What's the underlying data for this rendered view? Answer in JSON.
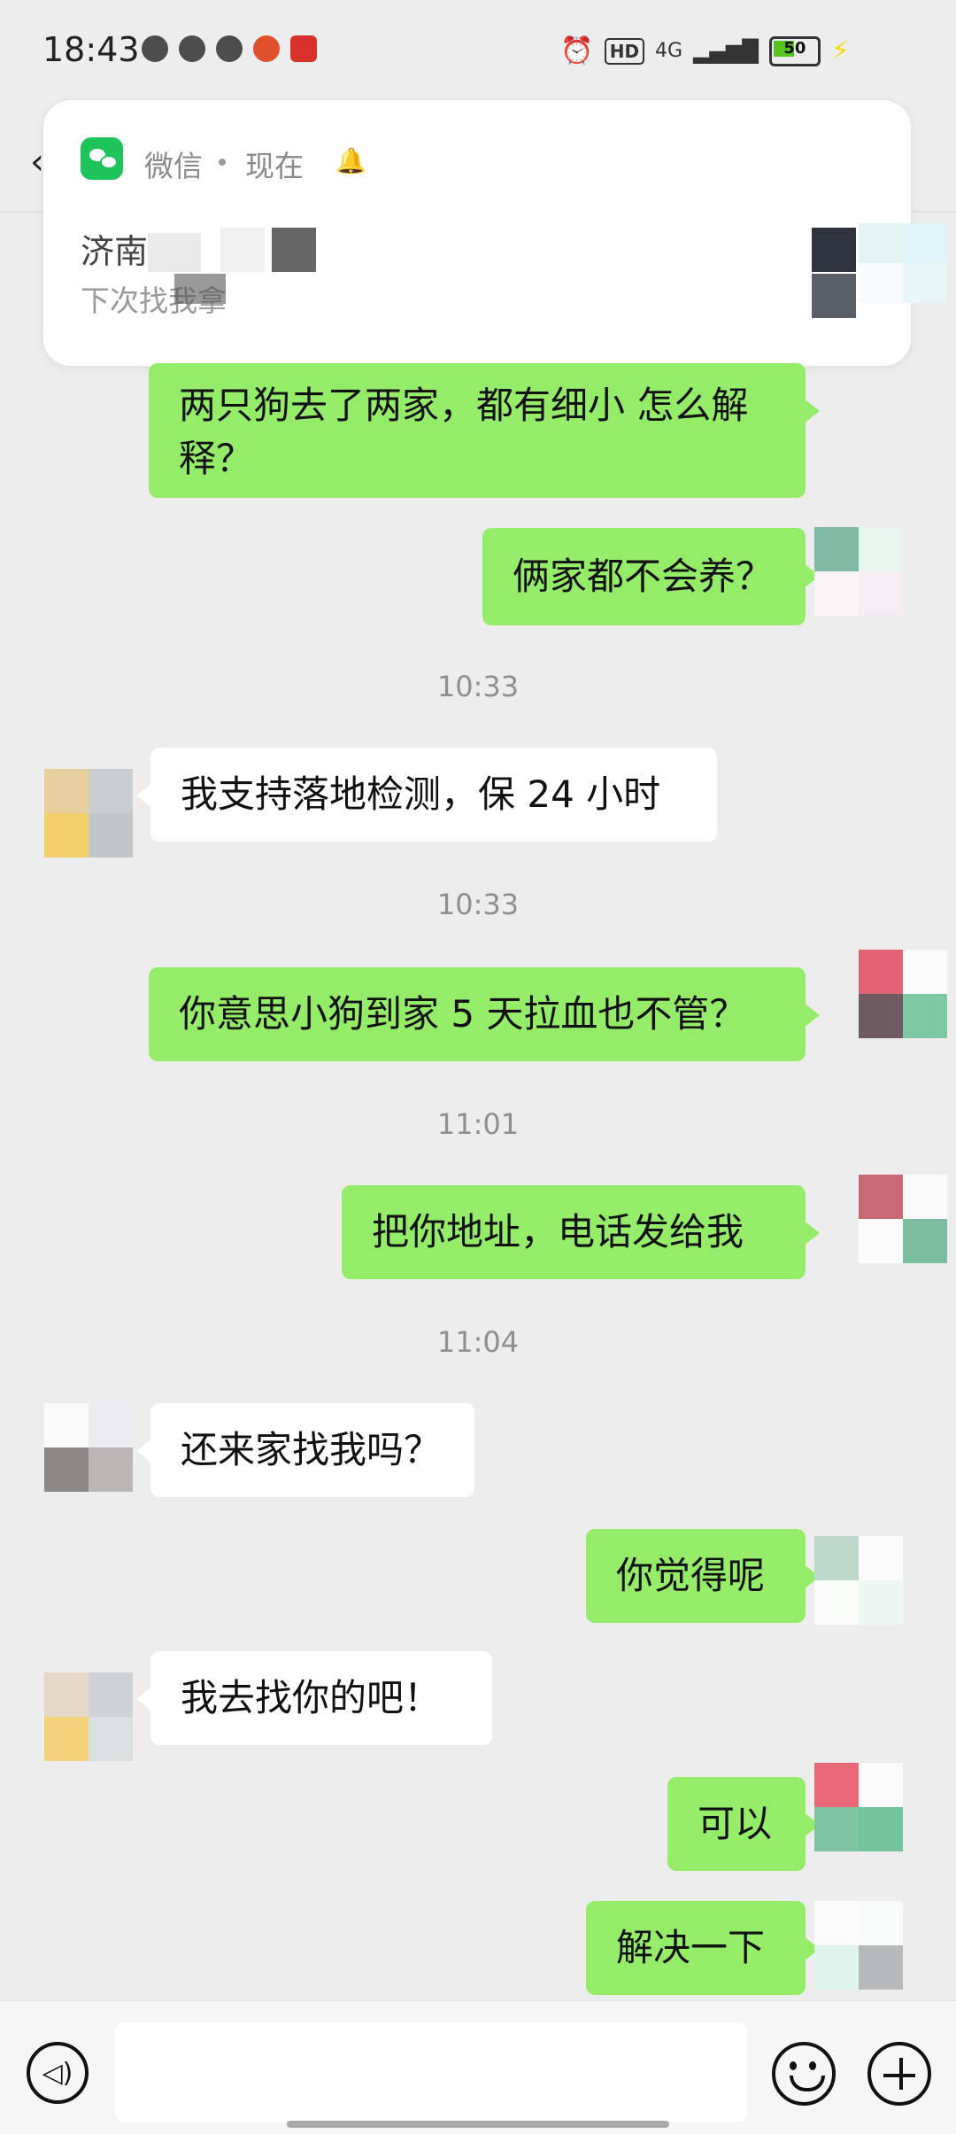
{
  "status_bar": {
    "time": "18:43",
    "network": "4G",
    "hd": "HD",
    "battery_level": "50",
    "icons": [
      "wechat-icon",
      "qq-browser-icon",
      "gauge-icon",
      "weibo-icon",
      "app-icon",
      "alarm-icon",
      "hd-icon",
      "signal-icon",
      "battery-icon",
      "charging-icon"
    ]
  },
  "notification": {
    "app_name": "微信",
    "time": "现在",
    "sender_visible": "济南",
    "message_visible": "下次找我拿"
  },
  "messages": [
    {
      "side": "me",
      "text": "两只狗去了两家，都有细小 怎么解释？"
    },
    {
      "side": "me",
      "text": "俩家都不会养？"
    },
    {
      "side": "time",
      "text": "10:33"
    },
    {
      "side": "them",
      "text": "我支持落地检测，保 24 小时"
    },
    {
      "side": "time",
      "text": "10:33"
    },
    {
      "side": "me",
      "text": "你意思小狗到家 5 天拉血也不管？"
    },
    {
      "side": "time",
      "text": "11:01"
    },
    {
      "side": "me",
      "text": "把你地址，电话发给我"
    },
    {
      "side": "time",
      "text": "11:04"
    },
    {
      "side": "them",
      "text": "还来家找我吗？"
    },
    {
      "side": "me",
      "text": "你觉得呢"
    },
    {
      "side": "them",
      "text": "我去找你的吧！"
    },
    {
      "side": "me",
      "text": "可以"
    },
    {
      "side": "me",
      "text": "解决一下"
    }
  ],
  "colors": {
    "my_bubble": "#95ec69",
    "their_bubble": "#ffffff",
    "background": "#ededed"
  }
}
